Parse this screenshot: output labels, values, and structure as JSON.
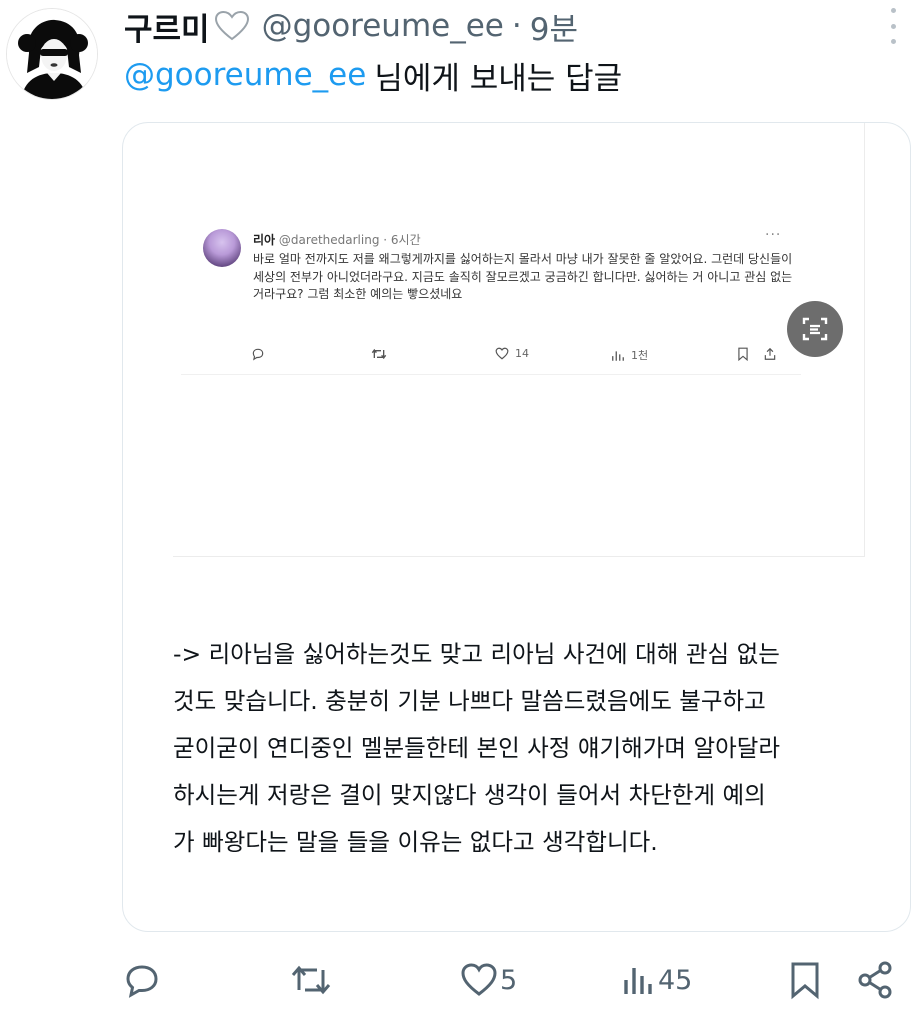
{
  "tweet": {
    "display_name": "구르미",
    "handle": "@gooreume_ee",
    "separator": "·",
    "time": "9분",
    "reply_handle": "@gooreume_ee",
    "reply_suffix": "님에게 보내는 답글",
    "body_lines": [
      "-> 리아님을 싫어하는것도 맞고 리아님 사건에 대해 관심 없는",
      "것도 맞습니다. 충분히 기분 나쁘다 말씀드렸음에도 불구하고",
      "굳이굳이 연디중인 멜분들한테 본인 사정 얘기해가며 알아달라",
      "하시는게 저랑은 결이 맞지않다 생각이 들어서 차단한게 예의",
      "가 빠왕다는 말을 들을 이유는 없다고 생각합니다."
    ],
    "actions": {
      "reply_icon": "reply-icon",
      "retweet_icon": "retweet-icon",
      "like_icon": "like-icon",
      "like_count": "5",
      "views_icon": "views-icon",
      "view_count": "45",
      "bookmark_icon": "bookmark-icon",
      "share_icon": "share-icon"
    }
  },
  "quoted_image": {
    "name": "리아",
    "handle": "@darethedarling",
    "separator": "·",
    "time": "6시간",
    "more": "···",
    "text": "바로 얼마 전까지도 저를 왜그렇게까지를 싫어하는지 몰라서 마냥 내가 잘못한 줄 알았어요. 그런데 당신들이 세상의 전부가 아니었더라구요. 지금도 솔직히 잘모르겠고 궁금하긴 합니다만. 싫어하는 거 아니고 관심 없는 거라구요? 그럼 최소한 예의는 빻으셨네요",
    "like_count": "14",
    "view_count": "1천"
  },
  "colors": {
    "text": "#0f1419",
    "secondary": "#536471",
    "link": "#1d9bf0",
    "border": "#e1e8ed"
  }
}
